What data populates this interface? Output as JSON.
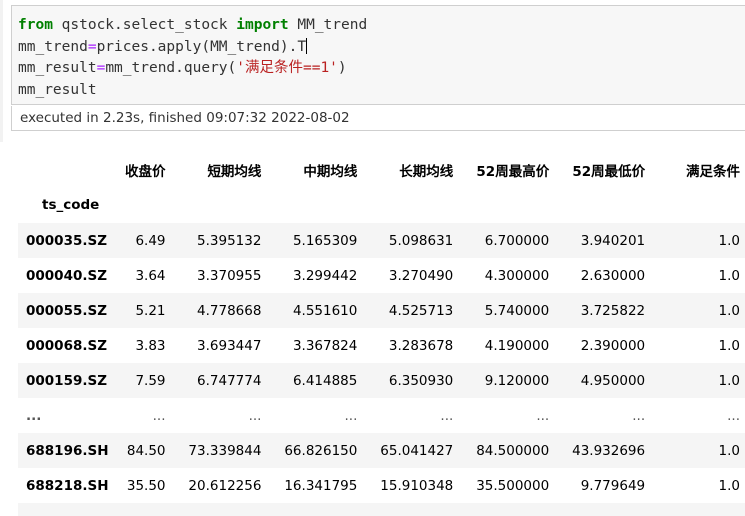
{
  "code": {
    "line1": {
      "kw_from": "from",
      "module": " qstock.select_stock ",
      "kw_import": "import",
      "name": " MM_trend"
    },
    "line2": {
      "a": "mm_trend",
      "eq": "=",
      "b": "prices.apply(MM_trend).T"
    },
    "line3": {
      "a": "mm_result",
      "eq": "=",
      "b": "mm_trend.query(",
      "str": "'满足条件==1'",
      "c": ")"
    },
    "line4": "mm_result"
  },
  "execution_status": "executed in 2.23s, finished 09:07:32 2022-08-02",
  "table": {
    "index_name": "ts_code",
    "columns": [
      "收盘价",
      "短期均线",
      "中期均线",
      "长期均线",
      "52周最高价",
      "52周最低价",
      "满足条件"
    ],
    "rows": [
      {
        "index": "000035.SZ",
        "values": [
          "6.49",
          "5.395132",
          "5.165309",
          "5.098631",
          "6.700000",
          "3.940201",
          "1.0"
        ]
      },
      {
        "index": "000040.SZ",
        "values": [
          "3.64",
          "3.370955",
          "3.299442",
          "3.270490",
          "4.300000",
          "2.630000",
          "1.0"
        ]
      },
      {
        "index": "000055.SZ",
        "values": [
          "5.21",
          "4.778668",
          "4.551610",
          "4.525713",
          "5.740000",
          "3.725822",
          "1.0"
        ]
      },
      {
        "index": "000068.SZ",
        "values": [
          "3.83",
          "3.693447",
          "3.367824",
          "3.283678",
          "4.190000",
          "2.390000",
          "1.0"
        ]
      },
      {
        "index": "000159.SZ",
        "values": [
          "7.59",
          "6.747774",
          "6.414885",
          "6.350930",
          "9.120000",
          "4.950000",
          "1.0"
        ]
      },
      {
        "index": "...",
        "values": [
          "...",
          "...",
          "...",
          "...",
          "...",
          "...",
          "..."
        ]
      },
      {
        "index": "688196.SH",
        "values": [
          "84.50",
          "73.339844",
          "66.826150",
          "65.041427",
          "84.500000",
          "43.932696",
          "1.0"
        ]
      },
      {
        "index": "688218.SH",
        "values": [
          "35.50",
          "20.612256",
          "16.341795",
          "15.910348",
          "35.500000",
          "9.779649",
          "1.0"
        ]
      },
      {
        "index": "",
        "values": [
          "",
          "",
          "",
          "",
          "",
          "",
          ""
        ]
      }
    ]
  }
}
